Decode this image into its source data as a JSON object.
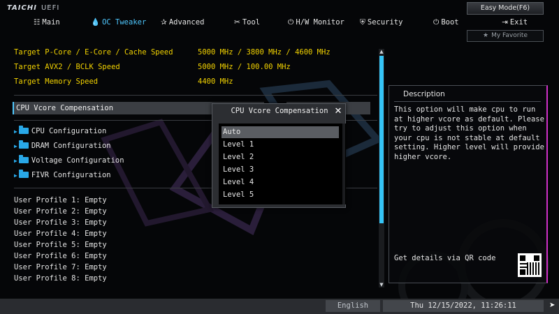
{
  "brand": {
    "logo": "TAICHI",
    "suffix": "UEFI"
  },
  "top_buttons": {
    "easy_mode": "Easy Mode(F6)",
    "favorite": "My Favorite"
  },
  "nav": [
    {
      "label": "Main",
      "icon": "grid-icon"
    },
    {
      "label": "OC Tweaker",
      "icon": "flame-icon",
      "active": true
    },
    {
      "label": "Advanced",
      "icon": "star-icon"
    },
    {
      "label": "Tool",
      "icon": "tools-icon"
    },
    {
      "label": "H/W Monitor",
      "icon": "power-monitor-icon"
    },
    {
      "label": "Security",
      "icon": "shield-icon"
    },
    {
      "label": "Boot",
      "icon": "power-icon"
    },
    {
      "label": "Exit",
      "icon": "exit-icon"
    }
  ],
  "settings": [
    {
      "label": "Target P-Core / E-Core / Cache Speed",
      "value": "5000 MHz / 3800 MHz / 4600 MHz"
    },
    {
      "label": "Target AVX2 / BCLK Speed",
      "value": "5000 MHz / 100.00 MHz"
    },
    {
      "label": "Target Memory Speed",
      "value": "4400 MHz"
    }
  ],
  "vcore": {
    "label": "CPU Vcore Compensation",
    "value": "Auto"
  },
  "folders": [
    "CPU Configuration",
    "DRAM Configuration",
    "Voltage Configuration",
    "FIVR Configuration"
  ],
  "profiles": [
    "User Profile 1: Empty",
    "User Profile 2: Empty",
    "User Profile 3: Empty",
    "User Profile 4: Empty",
    "User Profile 5: Empty",
    "User Profile 6: Empty",
    "User Profile 7: Empty",
    "User Profile 8: Empty"
  ],
  "description": {
    "title": "Description",
    "text": "This option will make cpu to run at higher vcore as default. Please try to adjust this option when your cpu is not stable at default setting. Higher level will provide higher vcore.",
    "qr_label": "Get details via QR code"
  },
  "modal": {
    "title": "CPU Vcore Compensation",
    "options": [
      "Auto",
      "Level 1",
      "Level 2",
      "Level 3",
      "Level 4",
      "Level 5"
    ],
    "selected_index": 0
  },
  "statusbar": {
    "language": "English",
    "datetime": "Thu 12/15/2022, 11:26:11"
  },
  "colors": {
    "accent": "#35c4f6",
    "value_yellow": "#f2d200",
    "desc_border": "#d030c8"
  }
}
